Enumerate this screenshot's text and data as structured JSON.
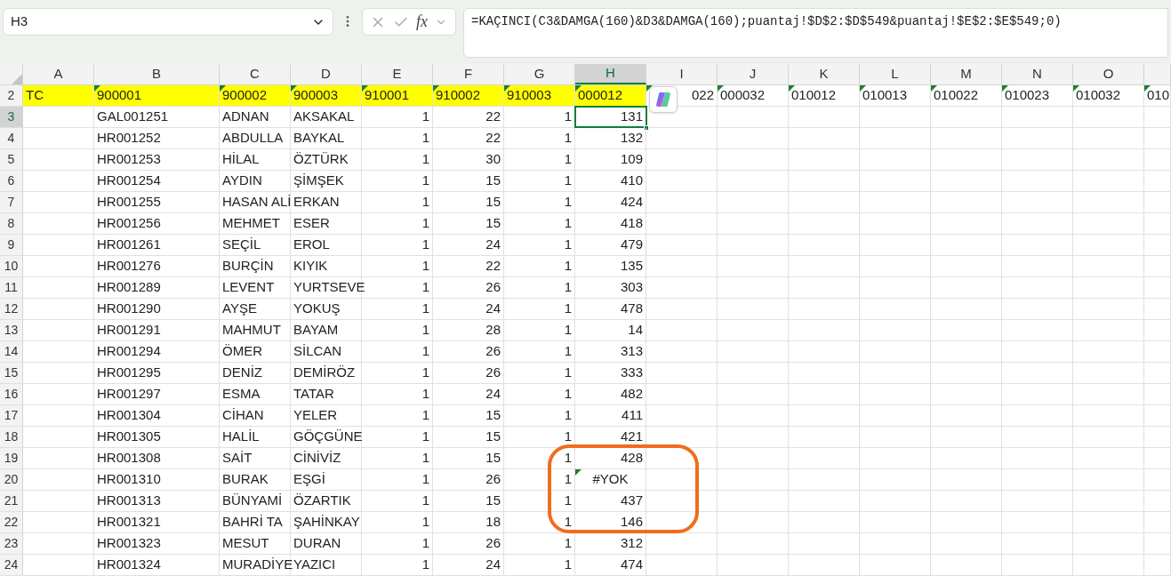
{
  "name_box": "H3",
  "formula": "=KAÇINCI(C3&DAMGA(160)&D3&DAMGA(160);puantaj!$D$2:$D$549&puantaj!$E$2:$E$549;0)",
  "fx_label": "fx",
  "columns": [
    {
      "label": "A",
      "selected": false
    },
    {
      "label": "B",
      "selected": false
    },
    {
      "label": "C",
      "selected": false
    },
    {
      "label": "D",
      "selected": false
    },
    {
      "label": "E",
      "selected": false
    },
    {
      "label": "F",
      "selected": false
    },
    {
      "label": "G",
      "selected": false
    },
    {
      "label": "H",
      "selected": true
    },
    {
      "label": "I",
      "selected": false
    },
    {
      "label": "J",
      "selected": false
    },
    {
      "label": "K",
      "selected": false
    },
    {
      "label": "L",
      "selected": false
    },
    {
      "label": "M",
      "selected": false
    },
    {
      "label": "N",
      "selected": false
    },
    {
      "label": "O",
      "selected": false
    }
  ],
  "header_row": {
    "num": "2",
    "highlighted": true,
    "cells": [
      {
        "text": "TC",
        "marker": false
      },
      {
        "text": "900001",
        "marker": true
      },
      {
        "text": "900002",
        "marker": true
      },
      {
        "text": "900003",
        "marker": true
      },
      {
        "text": "910001",
        "marker": true
      },
      {
        "text": "910002",
        "marker": true
      },
      {
        "text": "910003",
        "marker": true
      },
      {
        "text": "000012",
        "marker": true
      },
      {
        "text": "022",
        "marker": true
      },
      {
        "text": "000032",
        "marker": true
      },
      {
        "text": "010012",
        "marker": true
      },
      {
        "text": "010013",
        "marker": true
      },
      {
        "text": "010022",
        "marker": true
      },
      {
        "text": "010023",
        "marker": true
      },
      {
        "text": "010032",
        "marker": true
      },
      {
        "text": "010",
        "marker": true
      }
    ]
  },
  "rows": [
    {
      "num": "3",
      "selected": true,
      "cells": [
        "GAL001251",
        "ADNAN",
        "AKSAKAL",
        "1",
        "22",
        "1",
        "131"
      ]
    },
    {
      "num": "4",
      "selected": false,
      "cells": [
        "HR001252",
        "ABDULLA",
        "BAYKAL",
        "1",
        "22",
        "1",
        "132"
      ]
    },
    {
      "num": "5",
      "selected": false,
      "cells": [
        "HR001253",
        "HİLAL",
        "ÖZTÜRK",
        "1",
        "30",
        "1",
        "109"
      ]
    },
    {
      "num": "6",
      "selected": false,
      "cells": [
        "HR001254",
        "AYDIN",
        "ŞİMŞEK",
        "1",
        "15",
        "1",
        "410"
      ]
    },
    {
      "num": "7",
      "selected": false,
      "cells": [
        "HR001255",
        "HASAN ALİ",
        "ERKAN",
        "1",
        "15",
        "1",
        "424"
      ]
    },
    {
      "num": "8",
      "selected": false,
      "cells": [
        "HR001256",
        "MEHMET",
        "ESER",
        "1",
        "15",
        "1",
        "418"
      ]
    },
    {
      "num": "9",
      "selected": false,
      "cells": [
        "HR001261",
        "SEÇİL",
        "EROL",
        "1",
        "24",
        "1",
        "479"
      ]
    },
    {
      "num": "10",
      "selected": false,
      "cells": [
        "HR001276",
        "BURÇİN",
        "KIYIK",
        "1",
        "22",
        "1",
        "135"
      ]
    },
    {
      "num": "11",
      "selected": false,
      "cells": [
        "HR001289",
        "LEVENT",
        "YURTSEVE",
        "1",
        "26",
        "1",
        "303"
      ]
    },
    {
      "num": "12",
      "selected": false,
      "cells": [
        "HR001290",
        "AYŞE",
        "YOKUŞ",
        "1",
        "24",
        "1",
        "478"
      ]
    },
    {
      "num": "13",
      "selected": false,
      "cells": [
        "HR001291",
        "MAHMUT",
        "BAYAM",
        "1",
        "28",
        "1",
        "14"
      ]
    },
    {
      "num": "14",
      "selected": false,
      "cells": [
        "HR001294",
        "ÖMER",
        "SİLCAN",
        "1",
        "26",
        "1",
        "313"
      ]
    },
    {
      "num": "15",
      "selected": false,
      "cells": [
        "HR001295",
        "DENİZ",
        "DEMİRÖZ",
        "1",
        "26",
        "1",
        "333"
      ]
    },
    {
      "num": "16",
      "selected": false,
      "cells": [
        "HR001297",
        "ESMA",
        "TATAR",
        "1",
        "24",
        "1",
        "482"
      ]
    },
    {
      "num": "17",
      "selected": false,
      "cells": [
        "HR001304",
        "CİHAN",
        "YELER",
        "1",
        "15",
        "1",
        "411"
      ]
    },
    {
      "num": "18",
      "selected": false,
      "cells": [
        "HR001305",
        "HALİL",
        "GÖÇGÜNE",
        "1",
        "15",
        "1",
        "421"
      ]
    },
    {
      "num": "19",
      "selected": false,
      "cells": [
        "HR001308",
        "SAİT",
        "CİNİVİZ",
        "1",
        "15",
        "1",
        "428"
      ]
    },
    {
      "num": "20",
      "selected": false,
      "cells": [
        "HR001310",
        "BURAK",
        "EŞGİ",
        "1",
        "26",
        "1",
        {
          "text": "#YOK",
          "kind": "error",
          "marker": true
        }
      ]
    },
    {
      "num": "21",
      "selected": false,
      "cells": [
        "HR001313",
        "BÜNYAMİ",
        "ÖZARTIK",
        "1",
        "15",
        "1",
        "437"
      ]
    },
    {
      "num": "22",
      "selected": false,
      "cells": [
        "HR001321",
        "BAHRİ TA",
        "ŞAHİNKAY",
        "1",
        "18",
        "1",
        "146"
      ]
    },
    {
      "num": "23",
      "selected": false,
      "cells": [
        "HR001323",
        "MESUT",
        "DURAN",
        "1",
        "26",
        "1",
        "312"
      ]
    },
    {
      "num": "24",
      "selected": false,
      "cells": [
        "HR001324",
        "MURADİYE",
        "YAZICI",
        "1",
        "24",
        "1",
        "474"
      ]
    }
  ]
}
